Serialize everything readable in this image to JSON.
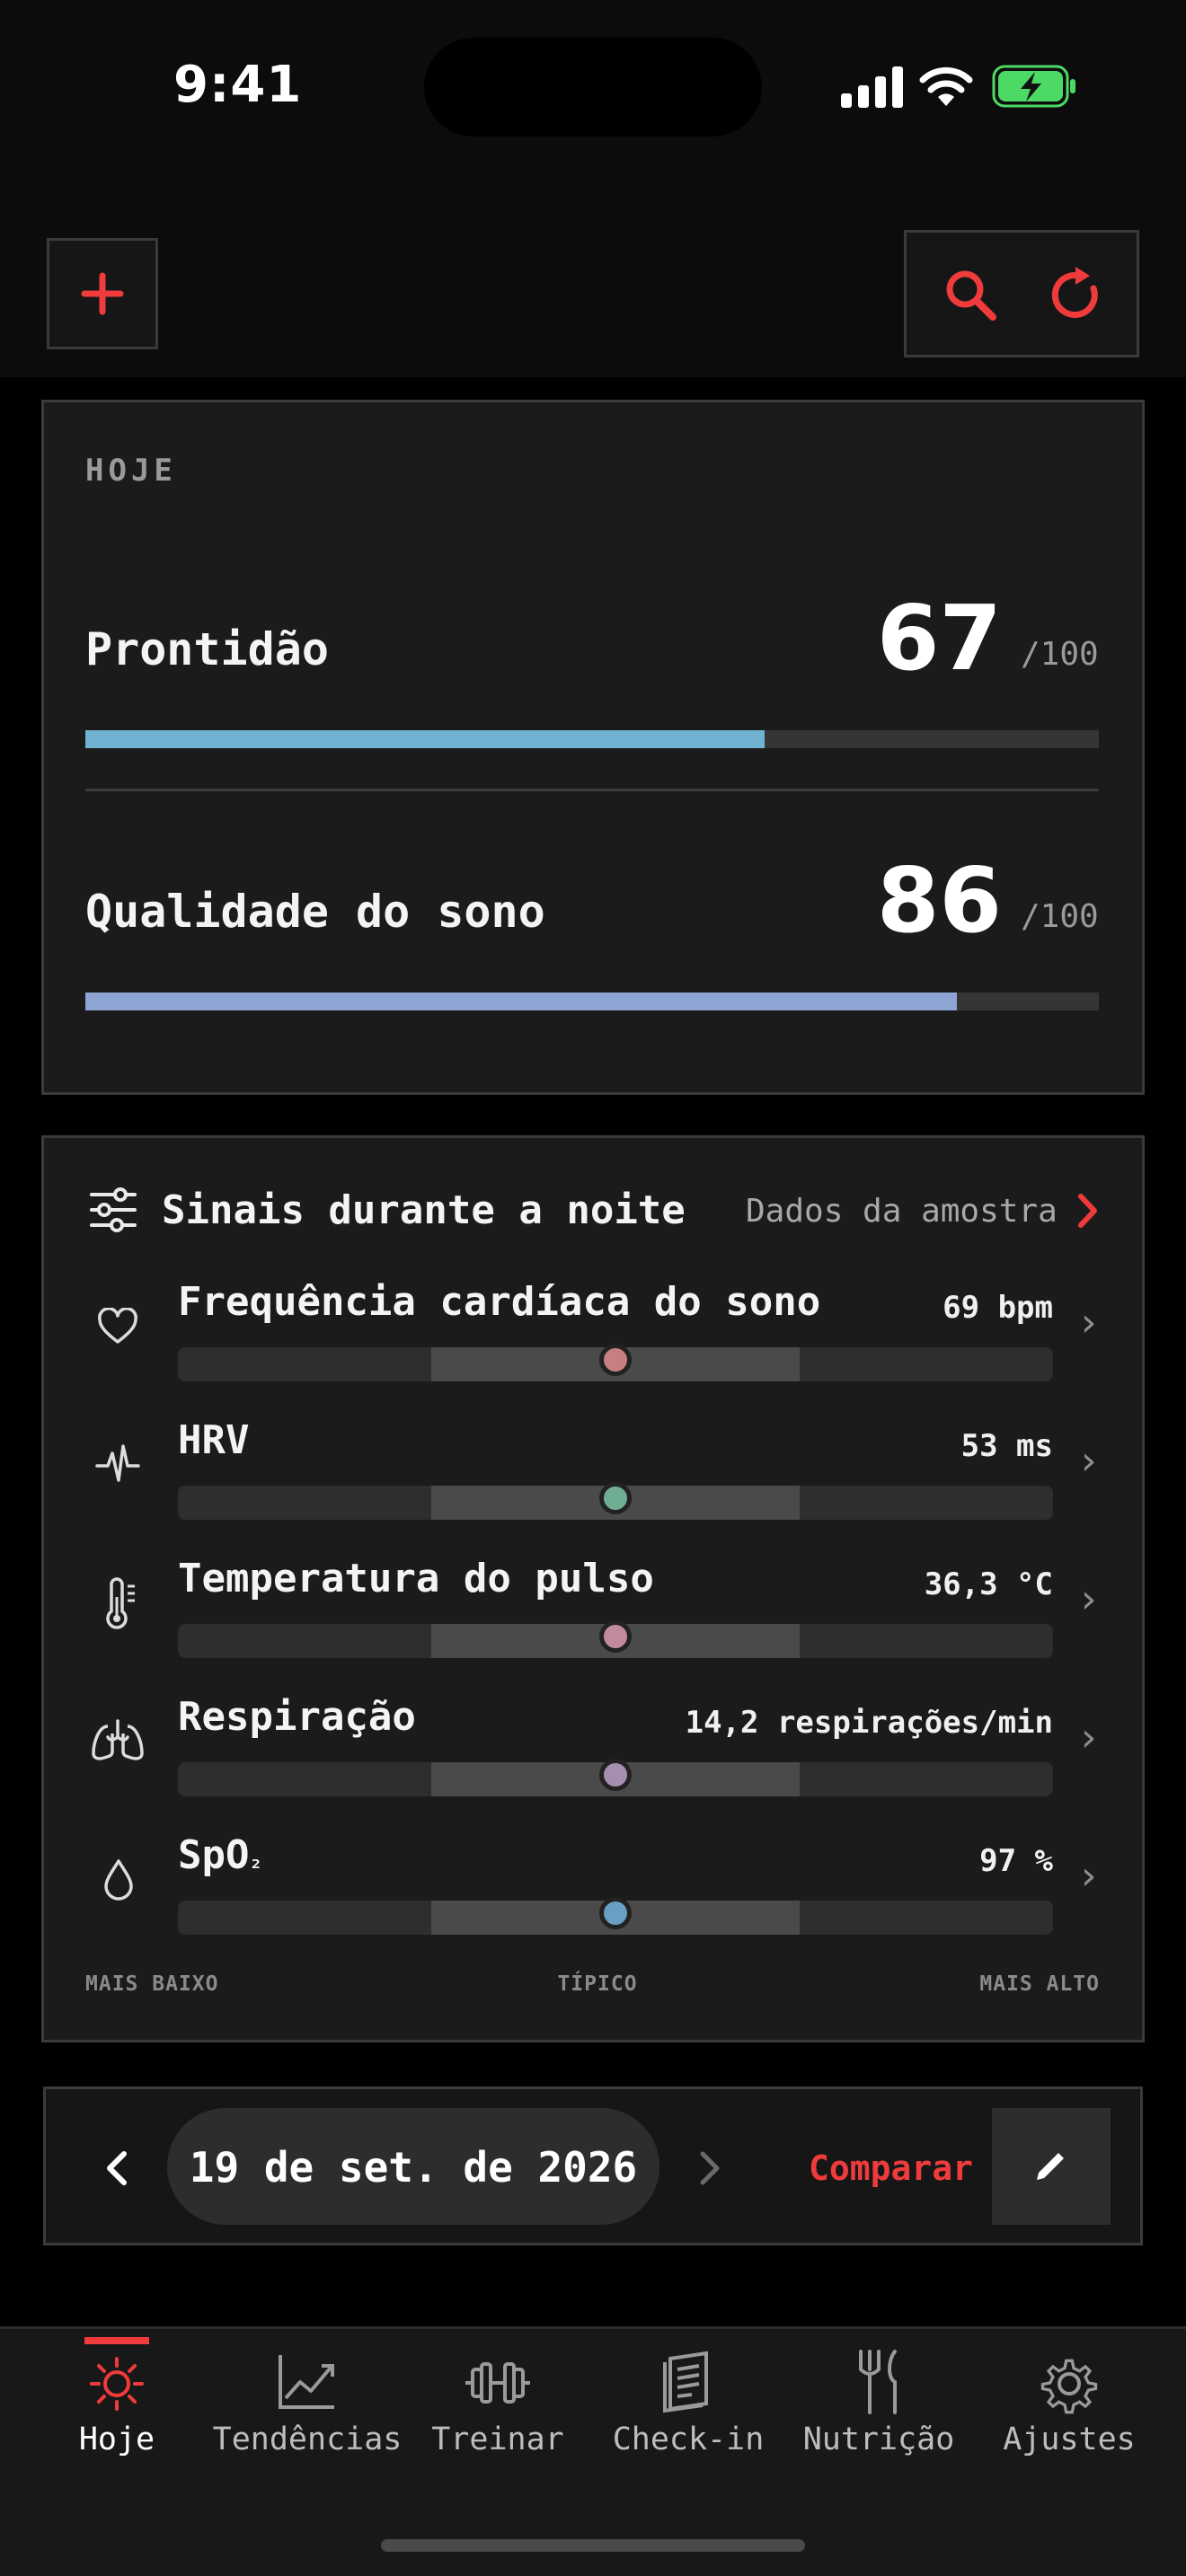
{
  "status_bar": {
    "time": "9:41"
  },
  "colors": {
    "accent": "#ef3b3b",
    "readiness": "#6fb2d2",
    "sleep": "#8ea4d2",
    "battery": "#4cd964"
  },
  "today": {
    "label": "HOJE",
    "metrics": [
      {
        "name": "Prontidão",
        "value": "67",
        "max": "/100",
        "progress": 0.67
      },
      {
        "name": "Qualidade do sono",
        "value": "86",
        "max": "/100",
        "progress": 0.86
      }
    ]
  },
  "signals": {
    "title": "Sinais durante a noite",
    "sample_label": "Dados da amostra",
    "items": [
      {
        "name": "Frequência cardíaca do sono",
        "value": "69 bpm",
        "icon": "heart-icon",
        "position": 0.5,
        "color": "#c87f82"
      },
      {
        "name": "HRV",
        "value": "53 ms",
        "icon": "pulse-icon",
        "position": 0.5,
        "color": "#6fae93"
      },
      {
        "name": "Temperatura do pulso",
        "value": "36,3 °C",
        "icon": "thermometer-icon",
        "position": 0.5,
        "color": "#c28b9c"
      },
      {
        "name": "Respiração",
        "value": "14,2 respirações/min",
        "icon": "lungs-icon",
        "position": 0.5,
        "color": "#a58fb1"
      },
      {
        "name": "SpO",
        "name_sub": "₂",
        "value": "97 %",
        "icon": "drop-icon",
        "position": 0.5,
        "color": "#6a9ec2"
      }
    ],
    "scale": {
      "low": "MAIS BAIXO",
      "mid": "TÍPICO",
      "high": "MAIS ALTO"
    }
  },
  "date_bar": {
    "date": "19 de set. de 2026",
    "compare_label": "Comparar"
  },
  "tabs": [
    {
      "label": "Hoje",
      "icon": "sun-icon",
      "active": true
    },
    {
      "label": "Tendências",
      "icon": "trend-icon",
      "active": false
    },
    {
      "label": "Treinar",
      "icon": "dumbbell-icon",
      "active": false
    },
    {
      "label": "Check-in",
      "icon": "notebook-icon",
      "active": false
    },
    {
      "label": "Nutrição",
      "icon": "fork-knife-icon",
      "active": false
    },
    {
      "label": "Ajustes",
      "icon": "gear-icon",
      "active": false
    }
  ]
}
